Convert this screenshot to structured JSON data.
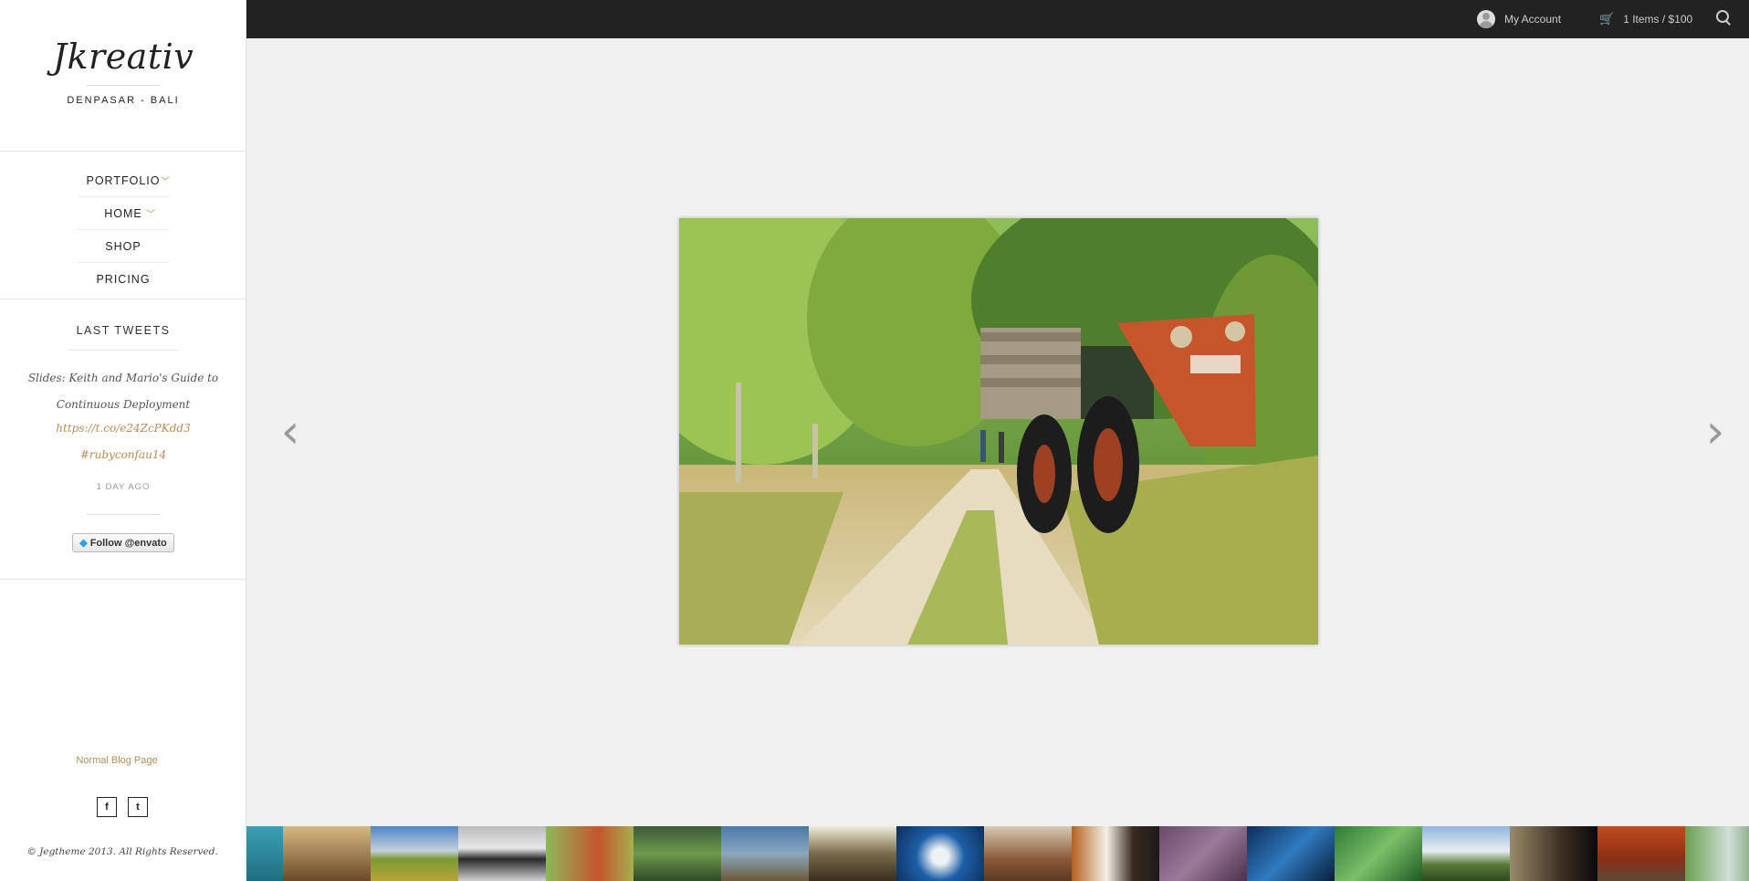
{
  "brand": {
    "logo": "Jkreativ",
    "tagline": "DENPASAR - BALI"
  },
  "nav": [
    {
      "label": "PORTFOLIO",
      "has_submenu": true
    },
    {
      "label": "HOME",
      "has_submenu": true
    },
    {
      "label": "SHOP",
      "has_submenu": false
    },
    {
      "label": "PRICING",
      "has_submenu": false
    }
  ],
  "tweets": {
    "title": "LAST TWEETS",
    "text": "Slides: Keith and Mario's Guide to Continuous Deployment",
    "link": "https://t.co/e24ZcPKdd3",
    "hashtag": "#rubyconfau14",
    "time": "1 DAY AGO",
    "follow_label": "Follow @envato"
  },
  "footer": {
    "blog_link": "Normal Blog Page",
    "social": [
      {
        "icon": "facebook-icon",
        "glyph": "f"
      },
      {
        "icon": "twitter-icon",
        "glyph": "t"
      }
    ],
    "copyright": "© Jegtheme 2013. All Rights Reserved."
  },
  "topbar": {
    "account_label": "My Account",
    "cart_label": "1 Items / $100"
  },
  "slider": {
    "prev_icon": "chevron-left-icon",
    "next_icon": "chevron-right-icon",
    "prev_glyph": "‹",
    "next_glyph": "›"
  },
  "colors": {
    "accent": "#b58d5a",
    "topbar": "#222222",
    "background": "#f0f0f0"
  }
}
